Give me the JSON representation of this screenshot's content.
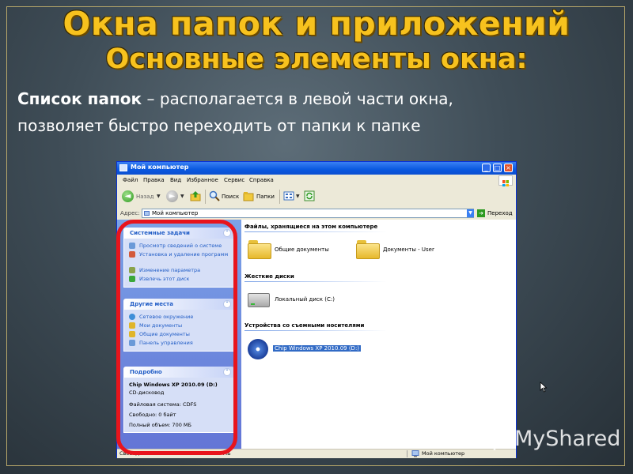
{
  "slide": {
    "title": "Окна папок и приложений",
    "subtitle": "Основные элементы окна:",
    "term": "Список папок",
    "dash": " – ",
    "description_line1": "располагается в левой части окна,",
    "description_line2": "позволяет быстро переходить от папки к папке",
    "accent_color": "#f7c21e",
    "highlight_color": "#e8141c"
  },
  "window": {
    "title": "Мой компьютер",
    "menu": [
      "Файл",
      "Правка",
      "Вид",
      "Избранное",
      "Сервис",
      "Справка"
    ],
    "toolbar": {
      "back": "Назад",
      "search": "Поиск",
      "folders": "Папки"
    },
    "address": {
      "label": "Адрес:",
      "value": "Мой компьютер",
      "go": "Переход"
    },
    "left_pane": {
      "system_tasks": {
        "title": "Системные задачи",
        "items": [
          "Просмотр сведений о системе",
          "Установка и удаление программ",
          "Изменение параметра",
          "Извлечь этот диск"
        ]
      },
      "other_places": {
        "title": "Другие места",
        "items": [
          "Сетевое окружение",
          "Мои документы",
          "Общие документы",
          "Панель управления"
        ]
      },
      "details": {
        "title": "Подробно",
        "name": "Chip Windows XP 2010.09 (D:)",
        "type": "CD-дисковод",
        "fs": "Файловая система: CDFS",
        "free": "Свободно: 0 байт",
        "total": "Полный объем: 700 МБ"
      }
    },
    "content": {
      "group_files": "Файлы, хранящиеся на этом компьютере",
      "shared_docs": "Общие документы",
      "user_docs": "Документы - User",
      "group_drives": "Жесткие диски",
      "local_disk": "Локальный диск (C:)",
      "group_removable": "Устройства со съемными носителями",
      "cd_drive": "Chip Windows XP 2010.09 (D:)"
    },
    "status": {
      "left": "Свободно: 0 байт Полный объем: 700 МБ",
      "right": "Мой компьютер"
    }
  },
  "watermark": "MyShared"
}
